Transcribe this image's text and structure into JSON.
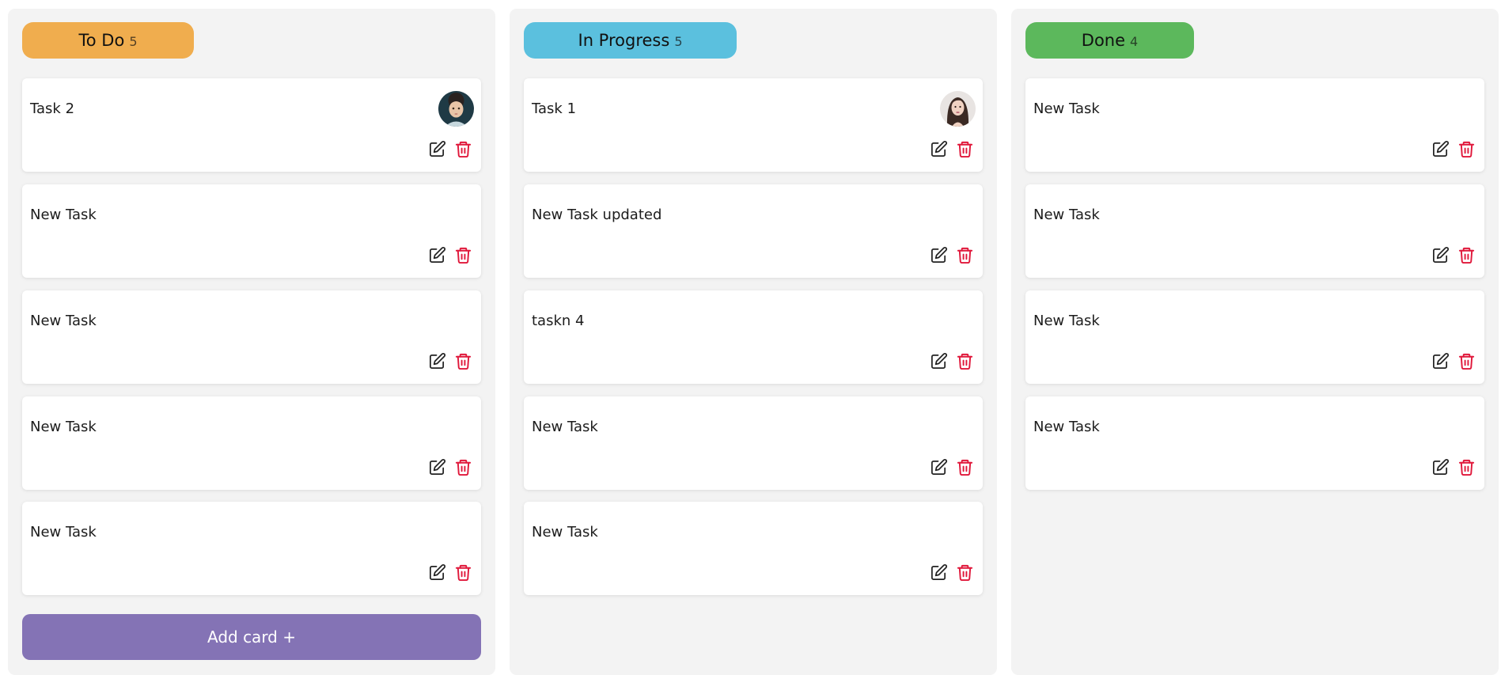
{
  "colors": {
    "board_background": "#ffffff",
    "column_background": "#f3f3f3",
    "todo": "#f0ad4e",
    "in_progress": "#5bc0de",
    "done": "#5cb85c",
    "add_card": "#8473b5",
    "delete_icon": "#e0173a",
    "edit_icon": "#222222"
  },
  "columns": [
    {
      "title": "To Do",
      "count": "5",
      "color": "#f0ad4e",
      "cards": [
        {
          "title": "Task 2",
          "avatar": "child-avatar"
        },
        {
          "title": "New Task"
        },
        {
          "title": "New Task"
        },
        {
          "title": "New Task"
        },
        {
          "title": "New Task"
        }
      ],
      "add_button": "Add card +"
    },
    {
      "title": "In Progress",
      "count": "5",
      "color": "#5bc0de",
      "cards": [
        {
          "title": "Task 1",
          "avatar": "woman-avatar"
        },
        {
          "title": "New Task updated"
        },
        {
          "title": "taskn 4"
        },
        {
          "title": "New Task"
        },
        {
          "title": "New Task"
        }
      ]
    },
    {
      "title": "Done",
      "count": "4",
      "color": "#5cb85c",
      "cards": [
        {
          "title": "New Task"
        },
        {
          "title": "New Task"
        },
        {
          "title": "New Task"
        },
        {
          "title": "New Task"
        }
      ]
    }
  ],
  "icons": {
    "edit": "edit-icon",
    "delete": "trash-icon"
  }
}
